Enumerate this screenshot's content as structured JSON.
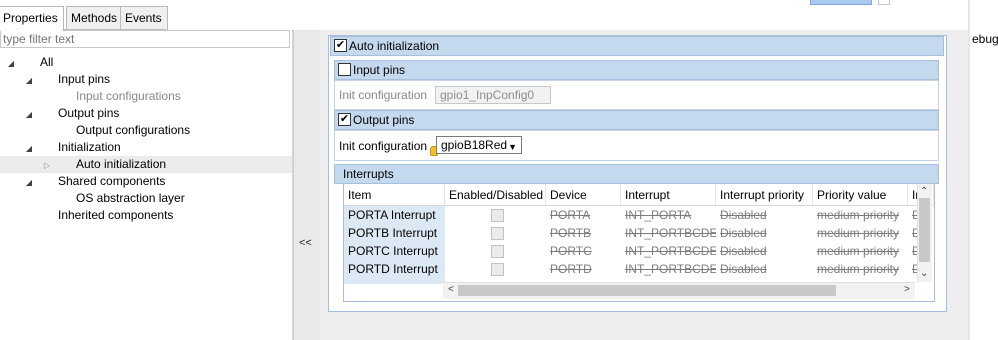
{
  "tabs": [
    {
      "label": "Properties",
      "active": true
    },
    {
      "label": "Methods",
      "active": false
    },
    {
      "label": "Events",
      "active": false
    }
  ],
  "debug_fragment": "ebug",
  "filter": {
    "placeholder": "type filter text"
  },
  "tree": [
    {
      "label": "All",
      "level": 0,
      "expanded": true,
      "muted": false
    },
    {
      "label": "Input pins",
      "level": 1,
      "expanded": true,
      "muted": false
    },
    {
      "label": "Input configurations",
      "level": 2,
      "muted": true
    },
    {
      "label": "Output pins",
      "level": 1,
      "expanded": true,
      "muted": false
    },
    {
      "label": "Output configurations",
      "level": 2,
      "muted": false
    },
    {
      "label": "Initialization",
      "level": 1,
      "expanded": true,
      "muted": false
    },
    {
      "label": "Auto initialization",
      "level": 2,
      "selected": true,
      "has_child": true,
      "muted": false
    },
    {
      "label": "Shared components",
      "level": 1,
      "expanded": true,
      "muted": false
    },
    {
      "label": "OS abstraction layer",
      "level": 2,
      "muted": false
    },
    {
      "label": "Inherited components",
      "level": 1,
      "muted": false
    }
  ],
  "splitter": {
    "collapse_label": "<<"
  },
  "auto_init": {
    "label": "Auto initialization",
    "checked": true,
    "check_glyph": "✔"
  },
  "input_pins": {
    "label": "Input pins",
    "checked": false,
    "init_label": "Init configuration",
    "init_value": "gpio1_InpConfig0"
  },
  "output_pins": {
    "label": "Output pins",
    "checked": true,
    "check_glyph": "✔",
    "init_label": "Init configuration",
    "init_value": "gpioB18Red"
  },
  "interrupts": {
    "title": "Interrupts",
    "columns": [
      "Item",
      "Enabled/Disabled",
      "Device",
      "Interrupt",
      "Interrupt priority",
      "Priority value",
      "In"
    ],
    "rows": [
      {
        "item": "PORTA Interrupt",
        "device": "PORTA",
        "interrupt": "INT_PORTA",
        "priority": "Disabled",
        "value": "medium priority",
        "trail": "D"
      },
      {
        "item": "PORTB Interrupt",
        "device": "PORTB",
        "interrupt": "INT_PORTBCDE",
        "priority": "Disabled",
        "value": "medium priority",
        "trail": "D"
      },
      {
        "item": "PORTC Interrupt",
        "device": "PORTC",
        "interrupt": "INT_PORTBCDE",
        "priority": "Disabled",
        "value": "medium priority",
        "trail": "D"
      },
      {
        "item": "PORTD Interrupt",
        "device": "PORTD",
        "interrupt": "INT_PORTBCDE",
        "priority": "Disabled",
        "value": "medium priority",
        "trail": "D"
      }
    ]
  }
}
